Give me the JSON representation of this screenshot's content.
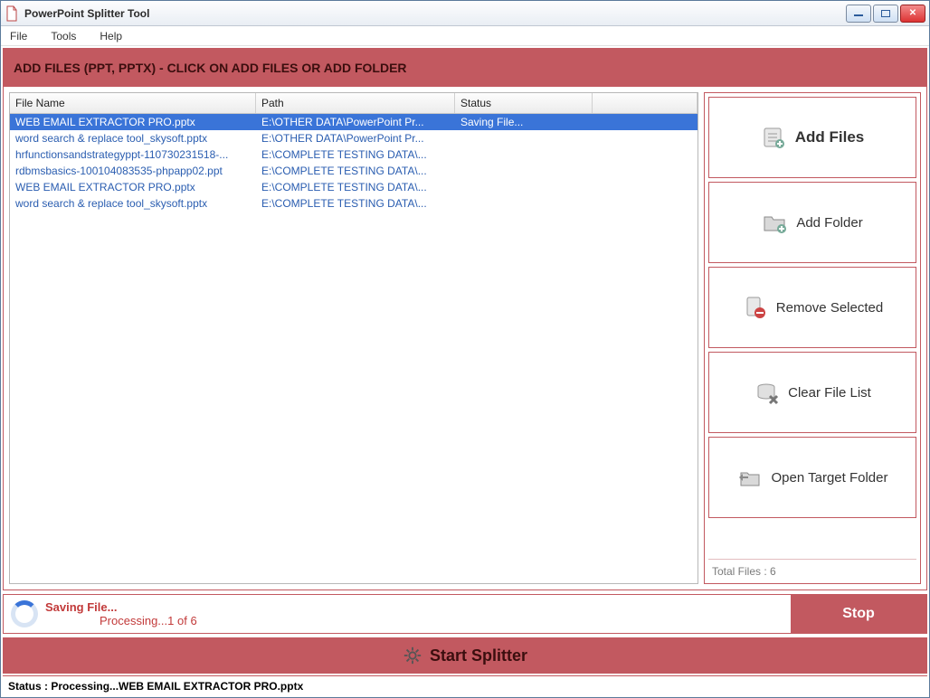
{
  "window": {
    "title": "PowerPoint Splitter Tool"
  },
  "menu": {
    "file": "File",
    "tools": "Tools",
    "help": "Help"
  },
  "banner": "ADD FILES (PPT, PPTX) - CLICK ON ADD FILES OR ADD FOLDER",
  "columns": {
    "filename": "File Name",
    "path": "Path",
    "status": "Status"
  },
  "rows": [
    {
      "filename": "WEB EMAIL EXTRACTOR PRO.pptx",
      "path": "E:\\OTHER DATA\\PowerPoint Pr...",
      "status": "Saving File...",
      "selected": true
    },
    {
      "filename": "word search & replace tool_skysoft.pptx",
      "path": "E:\\OTHER DATA\\PowerPoint Pr...",
      "status": ""
    },
    {
      "filename": "hrfunctionsandstrategyppt-110730231518-...",
      "path": "E:\\COMPLETE TESTING DATA\\...",
      "status": ""
    },
    {
      "filename": "rdbmsbasics-100104083535-phpapp02.ppt",
      "path": "E:\\COMPLETE TESTING DATA\\...",
      "status": ""
    },
    {
      "filename": "WEB EMAIL EXTRACTOR PRO.pptx",
      "path": "E:\\COMPLETE TESTING DATA\\...",
      "status": ""
    },
    {
      "filename": "word search & replace tool_skysoft.pptx",
      "path": "E:\\COMPLETE TESTING DATA\\...",
      "status": ""
    }
  ],
  "buttons": {
    "add_files": "Add Files",
    "add_folder": "Add Folder",
    "remove_selected": "Remove Selected",
    "clear_list": "Clear File List",
    "open_target": "Open Target Folder",
    "stop": "Stop",
    "start": "Start Splitter"
  },
  "total_files": "Total Files : 6",
  "progress": {
    "line1": "Saving File...",
    "line2": "Processing...1 of 6"
  },
  "statusbar": "Status  :  Processing...WEB EMAIL EXTRACTOR PRO.pptx"
}
